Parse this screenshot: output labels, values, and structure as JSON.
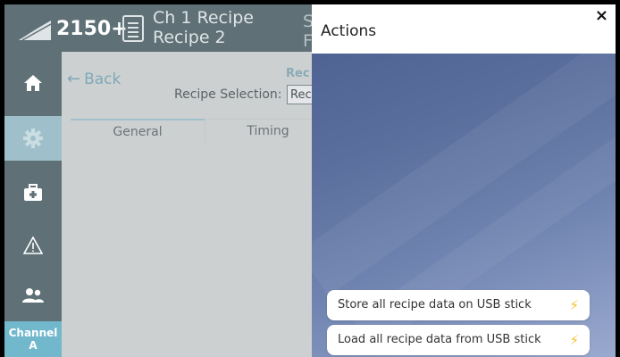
{
  "header": {
    "model": "2150+",
    "recipe_line1": "Ch 1 Recipe",
    "recipe_line2": "Recipe 2",
    "right_line1": "S",
    "right_line2": "F"
  },
  "sidebar": {
    "items": [
      {
        "name": "home",
        "icon": "home-icon"
      },
      {
        "name": "settings",
        "icon": "gear-icon"
      },
      {
        "name": "service",
        "icon": "medkit-icon"
      },
      {
        "name": "alarms",
        "icon": "warning-icon"
      },
      {
        "name": "users",
        "icon": "users-icon"
      }
    ],
    "channel_line1": "Channel",
    "channel_line2": "A"
  },
  "main": {
    "back_label": "Back",
    "heading_partial": "Rec",
    "selection_label": "Recipe Selection:",
    "selection_value": "Reci",
    "tabs": [
      {
        "label": "General"
      },
      {
        "label": "Timing"
      }
    ]
  },
  "panel": {
    "title": "Actions",
    "close_glyph": "×",
    "actions": [
      {
        "label": "Store all recipe data on USB stick",
        "icon": "lightning-icon"
      },
      {
        "label": "Load all recipe data from USB stick",
        "icon": "lightning-icon"
      }
    ]
  },
  "colors": {
    "topbar": "#5f7077",
    "sidebar_active": "#9fc0ca",
    "channel": "#72b8cc",
    "panel_gradient_start": "#4a5f8f",
    "panel_gradient_end": "#9aa9cf",
    "bolt": "#f4c12d"
  }
}
